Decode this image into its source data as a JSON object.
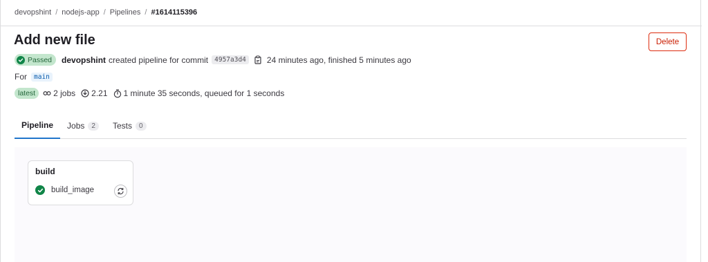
{
  "breadcrumb": {
    "items": [
      "devopshint",
      "nodejs-app",
      "Pipelines"
    ],
    "separator": "/",
    "current": "#1614115396"
  },
  "header": {
    "title": "Add new file",
    "delete_label": "Delete"
  },
  "pipeline_info": {
    "status": "Passed",
    "user": "devopshint",
    "action_text": "created pipeline for commit",
    "commit_sha": "4957a3d4",
    "time_text": "24 minutes ago, finished 5 minutes ago",
    "for_label": "For",
    "branch": "main",
    "latest_label": "latest",
    "jobs_text": "2 jobs",
    "version_text": "2.21",
    "duration_text": "1 minute 35 seconds, queued for 1 seconds"
  },
  "tabs": [
    {
      "label": "Pipeline",
      "count": null
    },
    {
      "label": "Jobs",
      "count": "2"
    },
    {
      "label": "Tests",
      "count": "0"
    }
  ],
  "graph": {
    "stage_name": "build",
    "job_name": "build_image"
  },
  "colors": {
    "success": "#108548",
    "danger": "#dd2b0e",
    "link": "#1f75cb"
  }
}
